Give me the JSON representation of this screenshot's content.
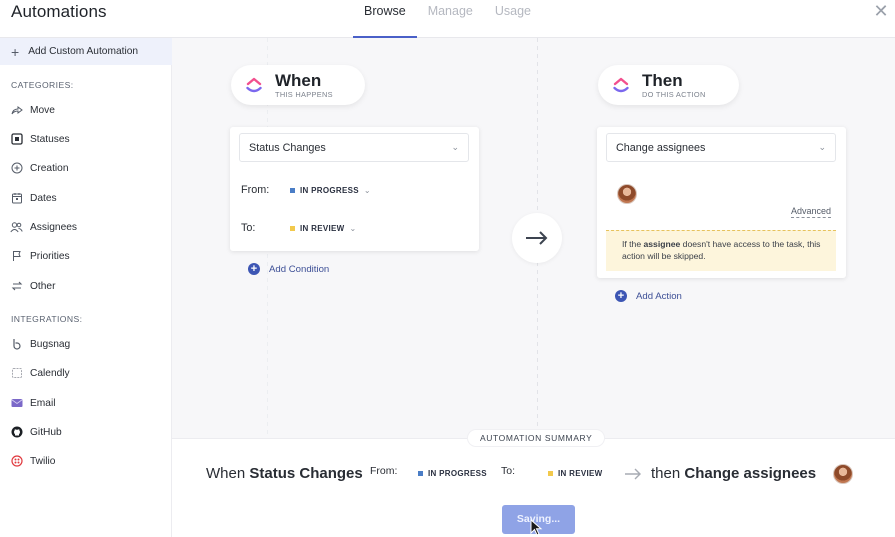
{
  "header": {
    "title": "Automations",
    "tabs": [
      "Browse",
      "Manage",
      "Usage"
    ],
    "active_tab": "Browse",
    "close_icon": "close-icon"
  },
  "sidebar": {
    "add_custom": "Add Custom Automation",
    "categories_label": "CATEGORIES:",
    "categories": [
      "Move",
      "Statuses",
      "Creation",
      "Dates",
      "Assignees",
      "Priorities",
      "Other"
    ],
    "integrations_label": "INTEGRATIONS:",
    "integrations": [
      "Bugsnag",
      "Calendly",
      "Email",
      "GitHub",
      "Twilio"
    ]
  },
  "when": {
    "title": "When",
    "subtitle": "THIS HAPPENS",
    "trigger": "Status Changes",
    "from_label": "From:",
    "from_status": "IN PROGRESS",
    "to_label": "To:",
    "to_status": "IN REVIEW",
    "add_condition": "Add Condition"
  },
  "then": {
    "title": "Then",
    "subtitle": "DO THIS ACTION",
    "action": "Change assignees",
    "advanced": "Advanced",
    "warning_pre": "If the ",
    "warning_bold": "assignee",
    "warning_post": " doesn't have access to the task, this action will be skipped.",
    "add_action": "Add Action"
  },
  "summary": {
    "label": "AUTOMATION SUMMARY",
    "when": "When",
    "trigger": "Status Changes",
    "from_label": "From:",
    "from_status": "IN PROGRESS",
    "to_label": "To:",
    "to_status": "IN REVIEW",
    "then": "then",
    "action": "Change assignees",
    "saving": "Saving..."
  },
  "colors": {
    "in_progress": "#4a7dc6",
    "in_review": "#f2c94c",
    "accent": "#3d56b4"
  }
}
